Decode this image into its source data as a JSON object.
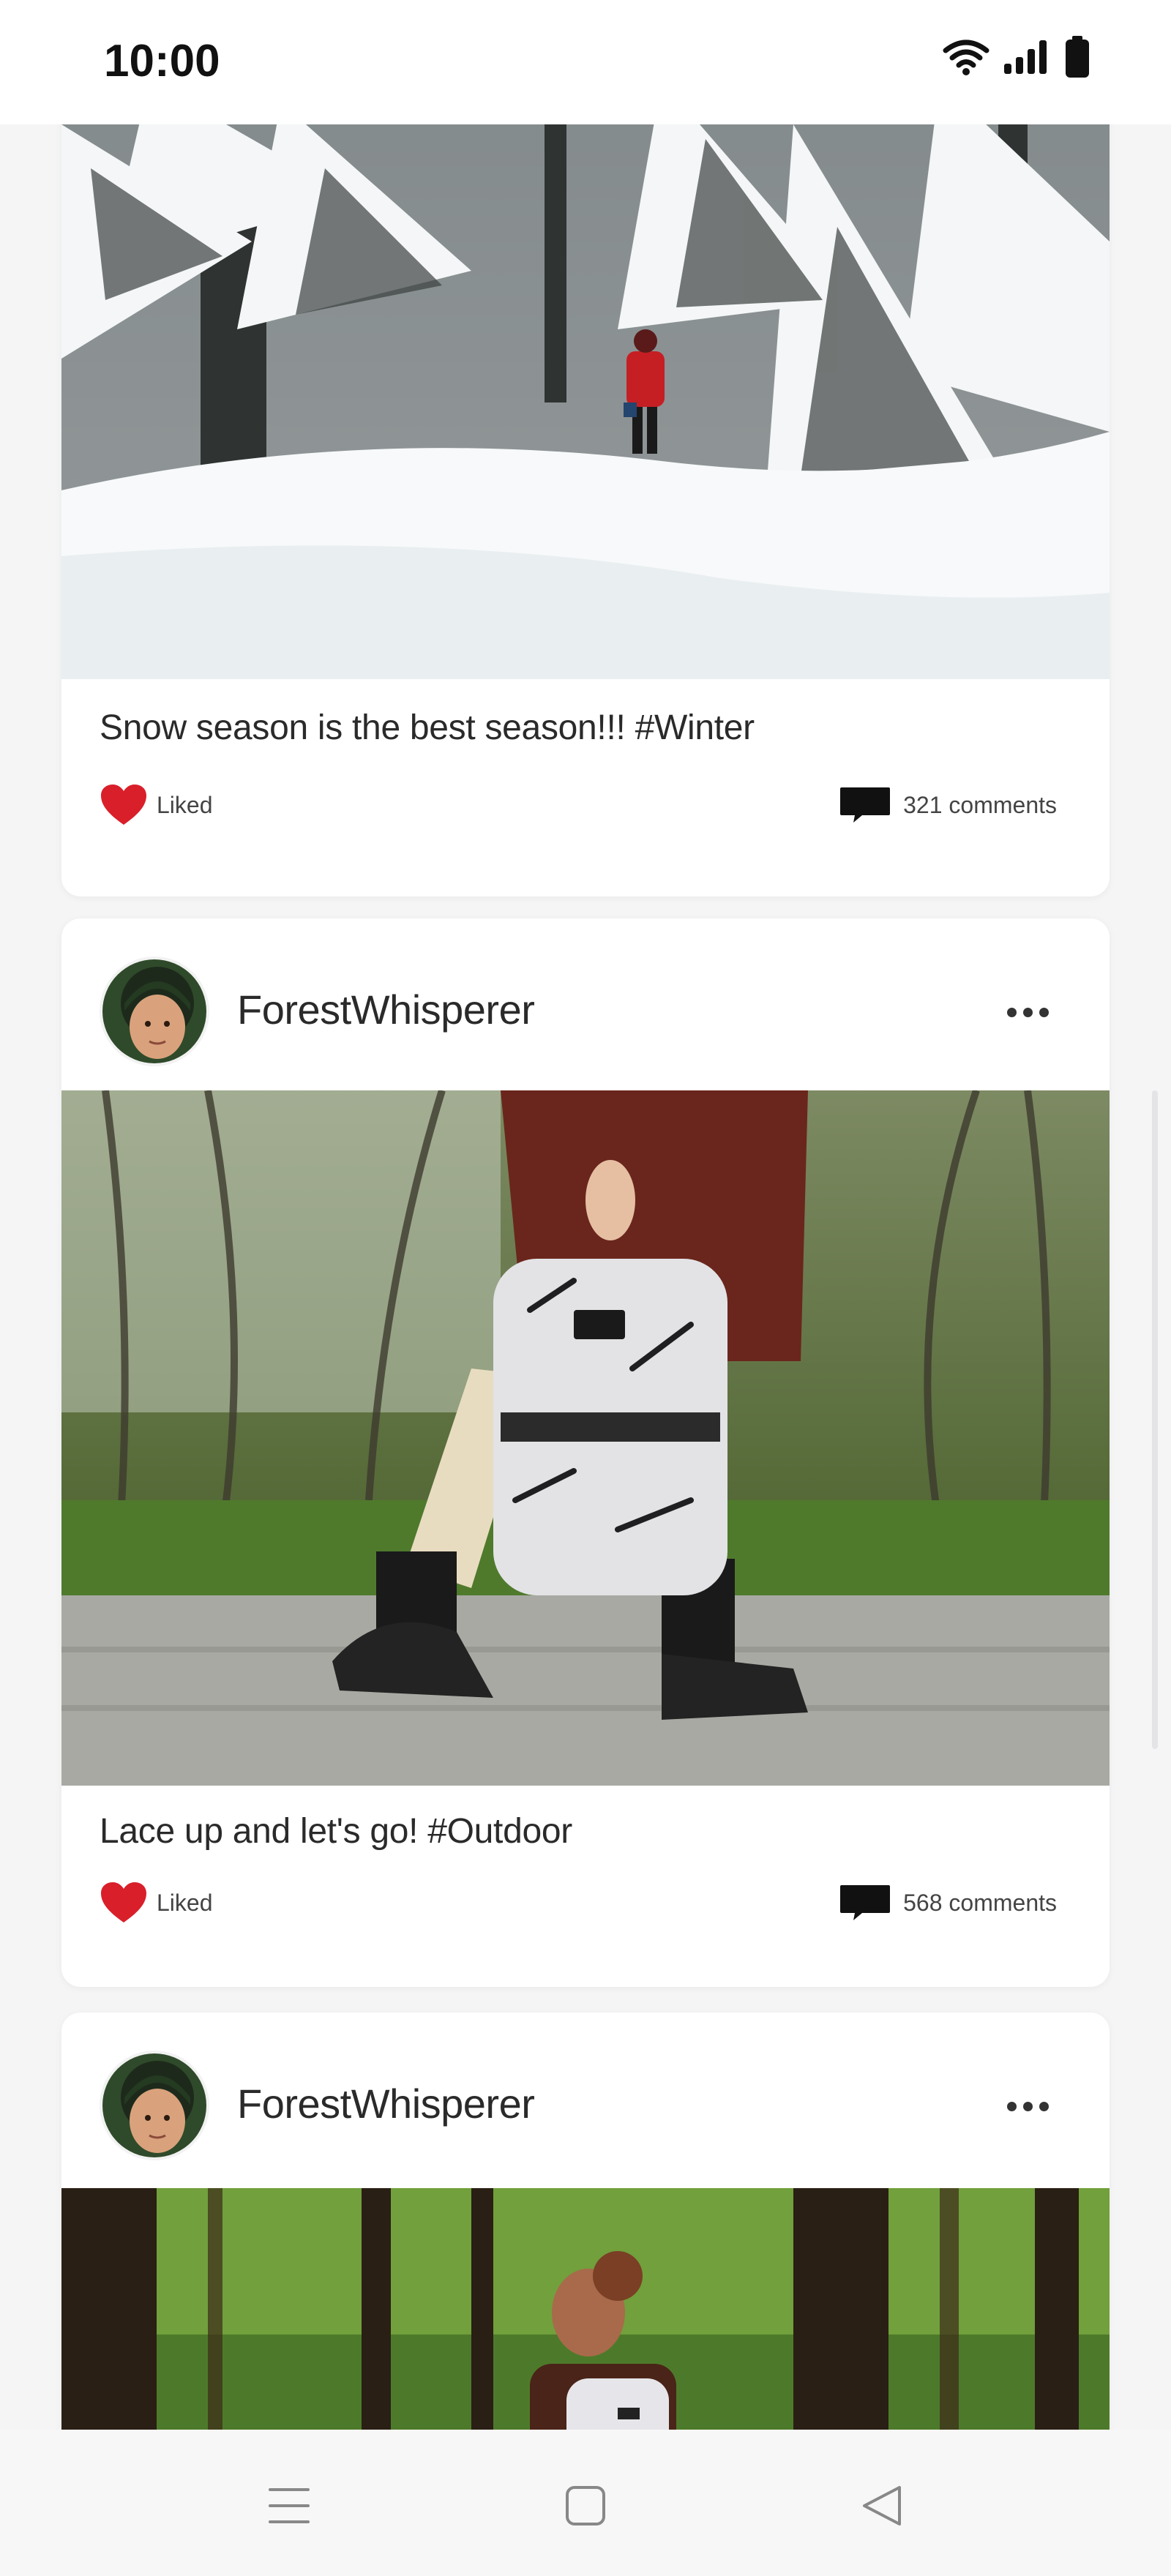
{
  "status_bar": {
    "time": "10:00",
    "icons": [
      "wifi-icon",
      "signal-icon",
      "battery-icon"
    ]
  },
  "posts": [
    {
      "caption": "Snow season is the best season!!! #Winter",
      "like_label": "Liked",
      "comments_label": "321 comments",
      "image": "snowy-forest-hiker"
    },
    {
      "username": "ForestWhisperer",
      "caption": "Lace up and let's go! #Outdoor",
      "like_label": "Liked",
      "comments_label": "568 comments",
      "image": "backpack-gravel-path"
    },
    {
      "username": "ForestWhisperer",
      "image": "woman-backpack-forest"
    }
  ],
  "nav": {
    "icons": [
      "menu-icon",
      "home-icon",
      "back-icon"
    ]
  },
  "colors": {
    "heart": "#d91f2a",
    "background": "#f5f5f6",
    "card": "#ffffff"
  }
}
